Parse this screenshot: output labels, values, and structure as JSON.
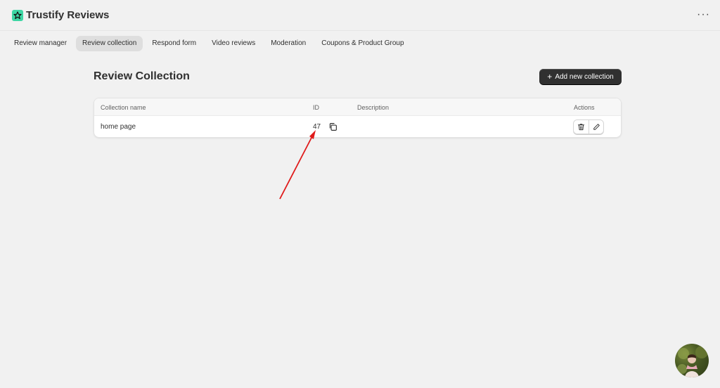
{
  "app": {
    "title": "Trustify Reviews",
    "more_label": "···"
  },
  "tabs": [
    {
      "label": "Review manager"
    },
    {
      "label": "Review collection",
      "active": true
    },
    {
      "label": "Respond form"
    },
    {
      "label": "Video reviews"
    },
    {
      "label": "Moderation"
    },
    {
      "label": "Coupons & Product Group"
    }
  ],
  "page": {
    "title": "Review Collection",
    "add_button": "Add new collection"
  },
  "table": {
    "columns": {
      "name": "Collection name",
      "id": "ID",
      "description": "Description",
      "actions": "Actions"
    },
    "rows": [
      {
        "name": "home page",
        "id": "47",
        "description": ""
      }
    ]
  },
  "colors": {
    "accent": "#3dd6a4",
    "annotation": "#e01b1b",
    "button_dark": "#303030"
  },
  "icons": [
    "star-logo-icon",
    "more-icon",
    "plus-icon",
    "copy-icon",
    "trash-icon",
    "pencil-icon"
  ]
}
